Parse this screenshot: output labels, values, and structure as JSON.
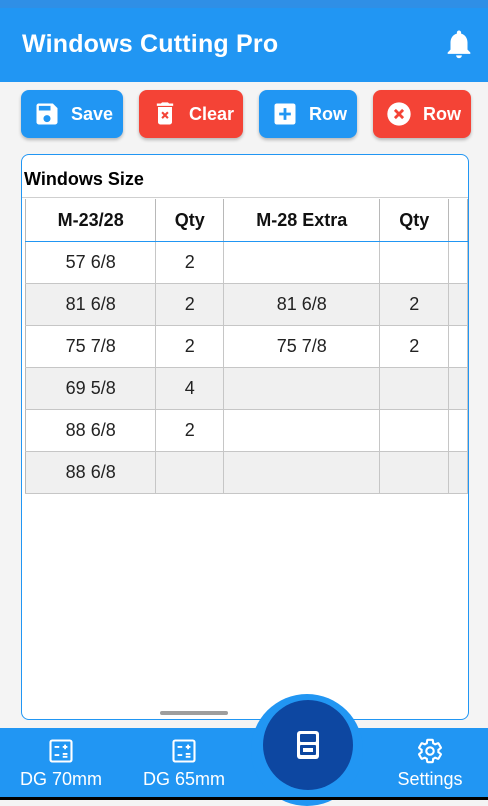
{
  "app": {
    "title": "Windows Cutting Pro",
    "icons": {
      "notifications": "bell-icon"
    }
  },
  "toolbar": {
    "save_label": "Save",
    "clear_label": "Clear",
    "add_row_label": "Row",
    "remove_row_label": "Row",
    "colors": {
      "primary": "#2196f3",
      "danger": "#f44336"
    }
  },
  "table": {
    "caption": "Windows Size",
    "headers": [
      "M-23/28",
      "Qty",
      "M-28 Extra",
      "Qty",
      ""
    ],
    "rows": [
      [
        "57 6/8",
        "2",
        "",
        "",
        ""
      ],
      [
        "81 6/8",
        "2",
        "81 6/8",
        "2",
        ""
      ],
      [
        "75 7/8",
        "2",
        "75 7/8",
        "2",
        ""
      ],
      [
        "69 5/8",
        "4",
        "",
        "",
        ""
      ],
      [
        "88 6/8",
        "2",
        "",
        "",
        ""
      ],
      [
        "88 6/8",
        "",
        "",
        "",
        ""
      ]
    ]
  },
  "bottom_nav": {
    "items": [
      {
        "label": "DG 70mm",
        "icon": "calculator-icon"
      },
      {
        "label": "DG 65mm",
        "icon": "calculator-icon"
      },
      {
        "label": "Settings",
        "icon": "gear-icon"
      }
    ],
    "fab_icon": "calculator-icon",
    "colors": {
      "bar": "#2196f3",
      "fab": "#0d47a1"
    }
  }
}
